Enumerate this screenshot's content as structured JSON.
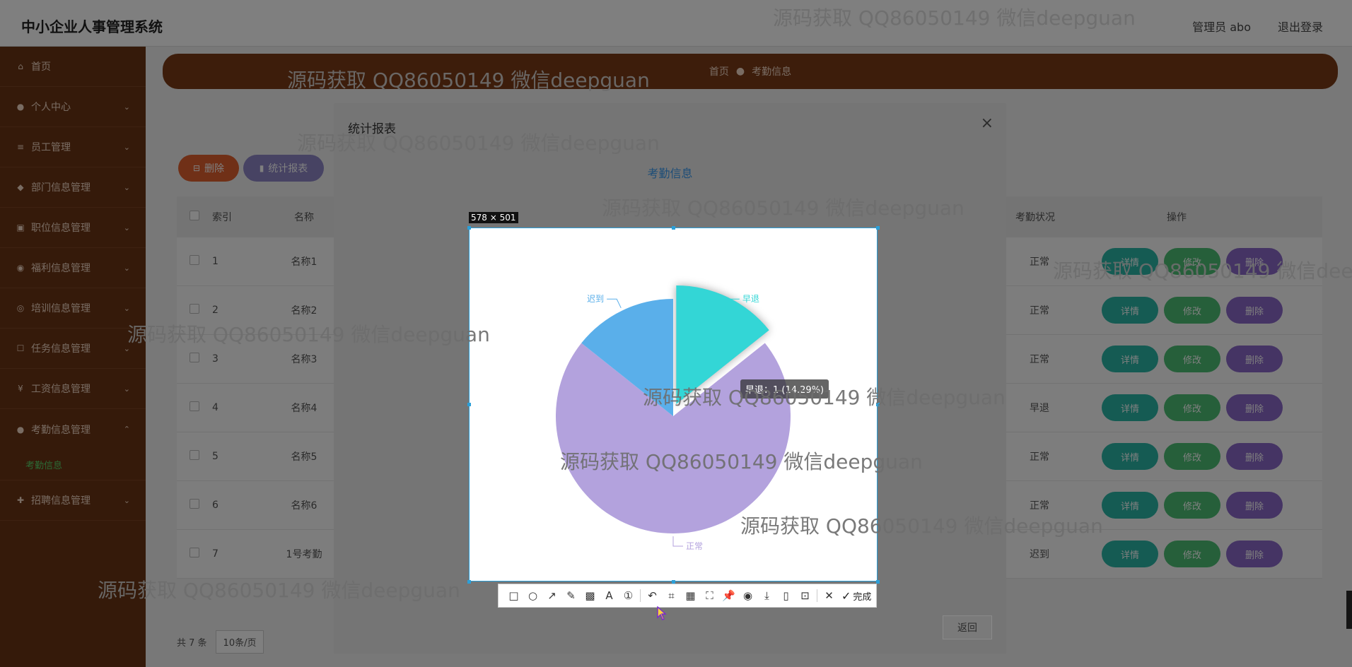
{
  "app": {
    "title": "中小企业人事管理系统",
    "user": "管理员 abo",
    "logout": "退出登录"
  },
  "sidebar": {
    "items": [
      {
        "label": "首页"
      },
      {
        "label": "个人中心"
      },
      {
        "label": "员工管理"
      },
      {
        "label": "部门信息管理"
      },
      {
        "label": "职位信息管理"
      },
      {
        "label": "福利信息管理"
      },
      {
        "label": "培训信息管理"
      },
      {
        "label": "任务信息管理"
      },
      {
        "label": "工资信息管理"
      },
      {
        "label": "考勤信息管理"
      },
      {
        "label": "招聘信息管理"
      }
    ],
    "active_sub": "考勤信息"
  },
  "breadcrumb": {
    "home": "首页",
    "current": "考勤信息"
  },
  "actions": {
    "delete": "删除",
    "report": "统计报表"
  },
  "table": {
    "headers": {
      "index": "索引",
      "name": "名称",
      "status": "考勤状况",
      "ops": "操作"
    },
    "rows": [
      {
        "index": "1",
        "name": "名称1",
        "status": "正常"
      },
      {
        "index": "2",
        "name": "名称2",
        "status": "正常"
      },
      {
        "index": "3",
        "name": "名称3",
        "status": "正常"
      },
      {
        "index": "4",
        "name": "名称4",
        "status": "早退"
      },
      {
        "index": "5",
        "name": "名称5",
        "status": "正常"
      },
      {
        "index": "6",
        "name": "名称6",
        "status": "正常"
      },
      {
        "index": "7",
        "name": "1号考勤",
        "status": "迟到"
      }
    ],
    "row_buttons": {
      "detail": "详情",
      "edit": "修改",
      "delete": "删除"
    }
  },
  "pager": {
    "total": "共 7 条",
    "size": "10条/页"
  },
  "modal": {
    "title": "统计报表",
    "close": "×",
    "chart_title": "考勤信息",
    "back": "返回"
  },
  "selection": {
    "size_label": "578 × 501"
  },
  "tooltip": "早退：1 (14.29%)",
  "toolbar": {
    "done": "完成"
  },
  "watermark": "源码获取 QQ86050149 微信deepguan",
  "chart_data": {
    "type": "pie",
    "title": "考勤信息",
    "slices": [
      {
        "label": "正常",
        "value": 5,
        "color": "#b3a2dd"
      },
      {
        "label": "迟到",
        "value": 1,
        "color": "#5aafea"
      },
      {
        "label": "早退",
        "value": 1,
        "color": "#33d6d6",
        "highlighted": true
      }
    ],
    "tooltip": "早退：1 (14.29%)"
  }
}
